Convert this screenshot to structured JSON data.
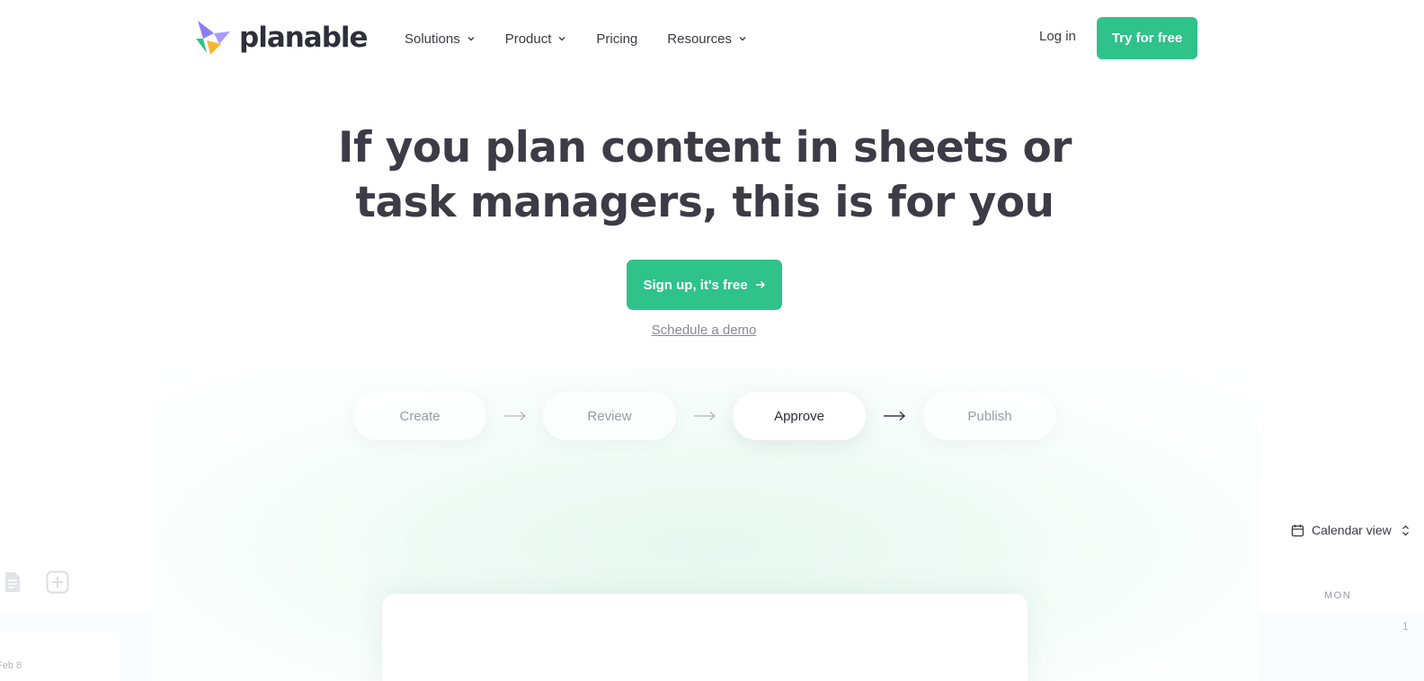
{
  "brand": {
    "name": "planable",
    "colors": {
      "primary": "#2fc28a",
      "logo_purple": "#8b7cf6",
      "logo_green": "#2fc28a",
      "logo_orange": "#f7b733",
      "text": "#3c3b46"
    }
  },
  "header": {
    "nav": [
      {
        "label": "Solutions",
        "has_dropdown": true
      },
      {
        "label": "Product",
        "has_dropdown": true
      },
      {
        "label": "Pricing",
        "has_dropdown": false
      },
      {
        "label": "Resources",
        "has_dropdown": true
      }
    ],
    "login_label": "Log in",
    "cta_label": "Try for free"
  },
  "hero": {
    "title_line1": "If you plan content in sheets or",
    "title_line2": "task managers, this is for you",
    "signup_label": "Sign up, it's free",
    "demo_label": "Schedule a demo"
  },
  "steps": [
    {
      "label": "Create",
      "active": false
    },
    {
      "label": "Review",
      "active": false
    },
    {
      "label": "Approve",
      "active": true
    },
    {
      "label": "Publish",
      "active": false
    }
  ],
  "preview": {
    "left": {
      "date_label": "Feb 8",
      "icons": [
        "document-icon",
        "add-icon"
      ]
    },
    "right": {
      "view_label": "Calendar view",
      "weekday": "MON",
      "day": "1"
    }
  }
}
